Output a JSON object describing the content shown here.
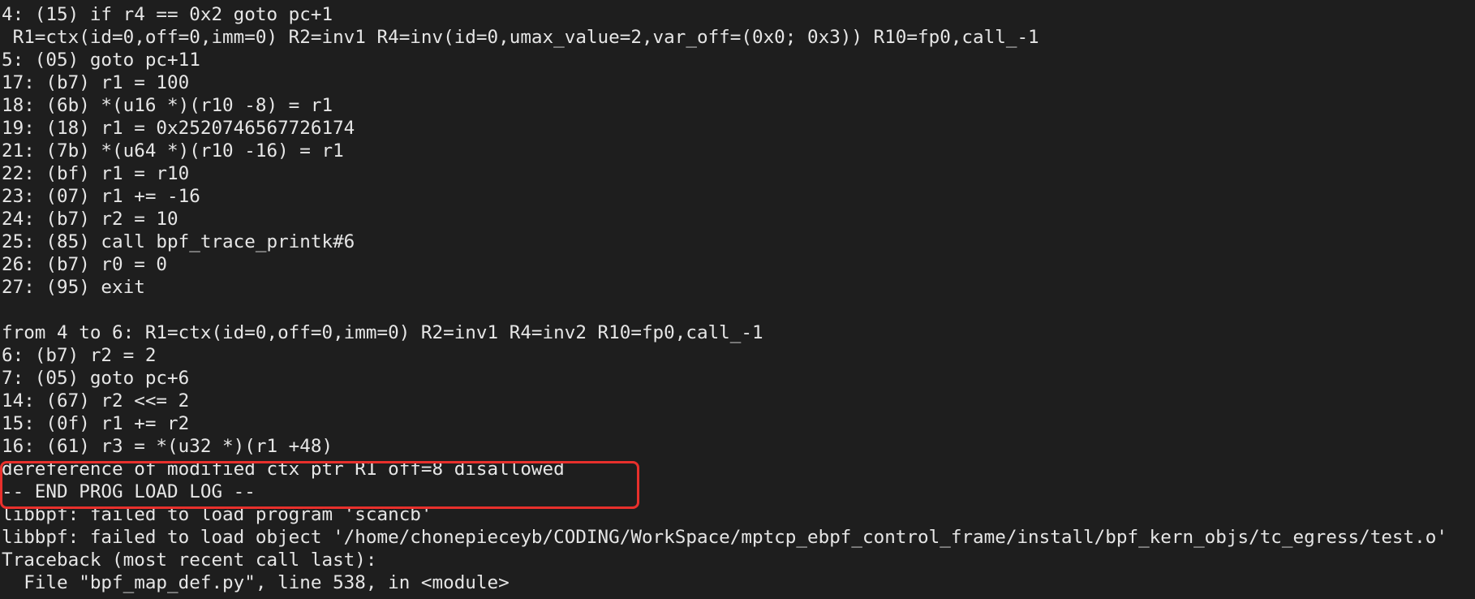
{
  "terminal": {
    "lines": [
      "4: (15) if r4 == 0x2 goto pc+1",
      " R1=ctx(id=0,off=0,imm=0) R2=inv1 R4=inv(id=0,umax_value=2,var_off=(0x0; 0x3)) R10=fp0,call_-1",
      "5: (05) goto pc+11",
      "17: (b7) r1 = 100",
      "18: (6b) *(u16 *)(r10 -8) = r1",
      "19: (18) r1 = 0x2520746567726174",
      "21: (7b) *(u64 *)(r10 -16) = r1",
      "22: (bf) r1 = r10",
      "23: (07) r1 += -16",
      "24: (b7) r2 = 10",
      "25: (85) call bpf_trace_printk#6",
      "26: (b7) r0 = 0",
      "27: (95) exit",
      "",
      "from 4 to 6: R1=ctx(id=0,off=0,imm=0) R2=inv1 R4=inv2 R10=fp0,call_-1",
      "6: (b7) r2 = 2",
      "7: (05) goto pc+6",
      "14: (67) r2 <<= 2",
      "15: (0f) r1 += r2",
      "16: (61) r3 = *(u32 *)(r1 +48)",
      "dereference of modified ctx ptr R1 off=8 disallowed",
      "-- END PROG LOAD LOG --",
      "libbpf: failed to load program 'scancb'",
      "libbpf: failed to load object '/home/chonepieceyb/CODING/WorkSpace/mptcp_ebpf_control_frame/install/bpf_kern_objs/tc_egress/test.o'",
      "Traceback (most recent call last):",
      "  File \"bpf_map_def.py\", line 538, in <module>"
    ],
    "highlight_color": "#e8302c",
    "background_color": "#1e1e1e",
    "text_color": "#e6e6e6"
  }
}
